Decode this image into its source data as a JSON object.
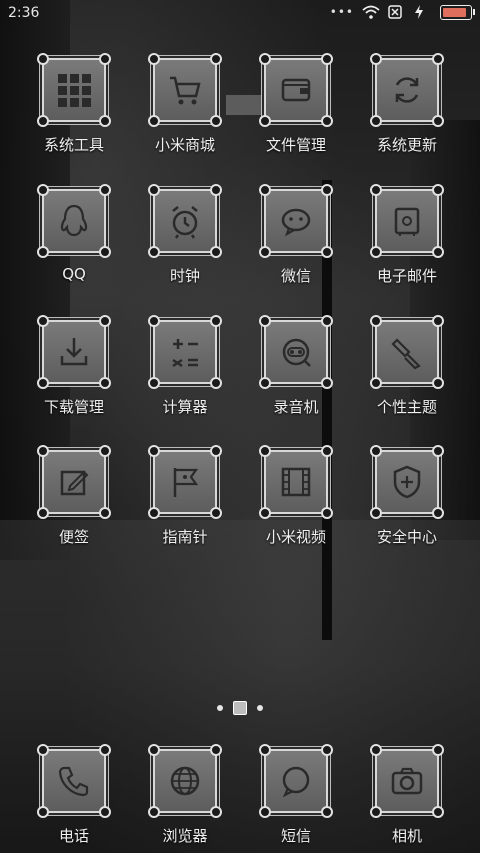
{
  "status_bar": {
    "time": "2:36",
    "battery_level_percent": 90,
    "battery_color": "#e06e5c"
  },
  "apps_row1": [
    {
      "label": "系统工具",
      "icon": "grid-icon"
    },
    {
      "label": "小米商城",
      "icon": "cart-icon"
    },
    {
      "label": "文件管理",
      "icon": "wallet-icon"
    },
    {
      "label": "系统更新",
      "icon": "refresh-icon"
    }
  ],
  "apps_row2": [
    {
      "label": "QQ",
      "icon": "penguin-icon"
    },
    {
      "label": "时钟",
      "icon": "alarm-clock-icon"
    },
    {
      "label": "微信",
      "icon": "chat-bubble-icon"
    },
    {
      "label": "电子邮件",
      "icon": "mail-safe-icon"
    }
  ],
  "apps_row3": [
    {
      "label": "下载管理",
      "icon": "download-icon"
    },
    {
      "label": "计算器",
      "icon": "calculator-icon"
    },
    {
      "label": "录音机",
      "icon": "recorder-icon"
    },
    {
      "label": "个性主题",
      "icon": "paint-brush-icon"
    }
  ],
  "apps_row4": [
    {
      "label": "便签",
      "icon": "notepad-icon"
    },
    {
      "label": "指南针",
      "icon": "compass-flag-icon"
    },
    {
      "label": "小米视频",
      "icon": "film-icon"
    },
    {
      "label": "安全中心",
      "icon": "shield-icon"
    }
  ],
  "dock": [
    {
      "label": "电话",
      "icon": "phone-icon"
    },
    {
      "label": "浏览器",
      "icon": "globe-icon"
    },
    {
      "label": "短信",
      "icon": "message-icon"
    },
    {
      "label": "相机",
      "icon": "camera-icon"
    }
  ]
}
